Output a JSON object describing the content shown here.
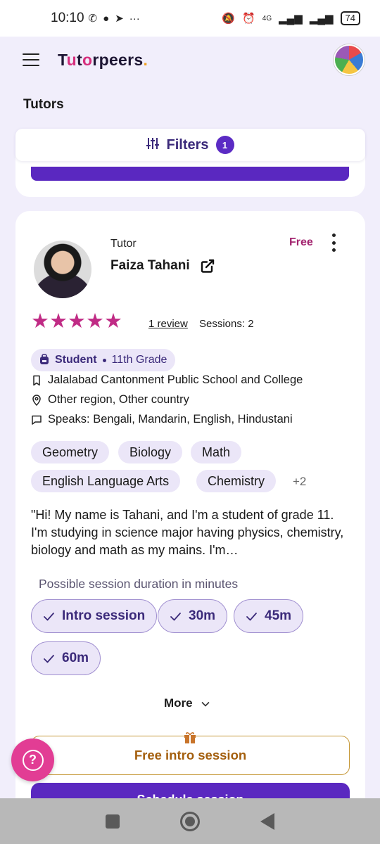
{
  "status_bar": {
    "time": "10:10",
    "battery": "74",
    "network": "4G",
    "left_icons": [
      "viber-icon",
      "chat-icon",
      "telegram-icon",
      "more-dots-icon"
    ],
    "right_icons": [
      "mute-icon",
      "alarm-icon",
      "signal-icon",
      "wifi-signal-icon",
      "battery-icon"
    ]
  },
  "header": {
    "logo_parts": [
      "T",
      "u",
      "t",
      "o",
      "rpeers",
      "."
    ],
    "menu_icon": "hamburger-icon",
    "avatar": "user-avatar"
  },
  "page": {
    "title": "Tutors"
  },
  "filters": {
    "label": "Filters",
    "count": "1",
    "icon": "sliders-icon"
  },
  "tutor": {
    "role": "Tutor",
    "name": "Faiza Tahani",
    "price": "Free",
    "rating": 5,
    "stars": "★★★★★",
    "reviews": "1 review",
    "sessions": "Sessions: 2",
    "status": "Student",
    "grade": "11th Grade",
    "school": "Jalalabad Cantonment Public School and College",
    "location": "Other region, Other country",
    "languages": "Speaks: Bengali, Mandarin, English, Hindustani",
    "subjects": [
      "Geometry",
      "Biology",
      "Math",
      "English Language Arts",
      "Chemistry"
    ],
    "more_subjects": "+2",
    "bio": "\"Hi! My name is Tahani, and I'm a student of grade 11. I'm studying in science major having physics, chemistry, biology and math as my mains. I'm…",
    "duration_label": "Possible session duration in minutes",
    "durations": [
      "Intro session",
      "30m",
      "45m",
      "60m"
    ],
    "more_label": "More",
    "free_intro_label": "Free intro session",
    "schedule_label": "Schedule session"
  },
  "colors": {
    "brand_purple": "#5a28c0",
    "accent_pink": "#c02b85",
    "free_gold": "#a45f0e",
    "chip_bg": "#ebe6f8",
    "page_bg": "#f1eefb"
  }
}
